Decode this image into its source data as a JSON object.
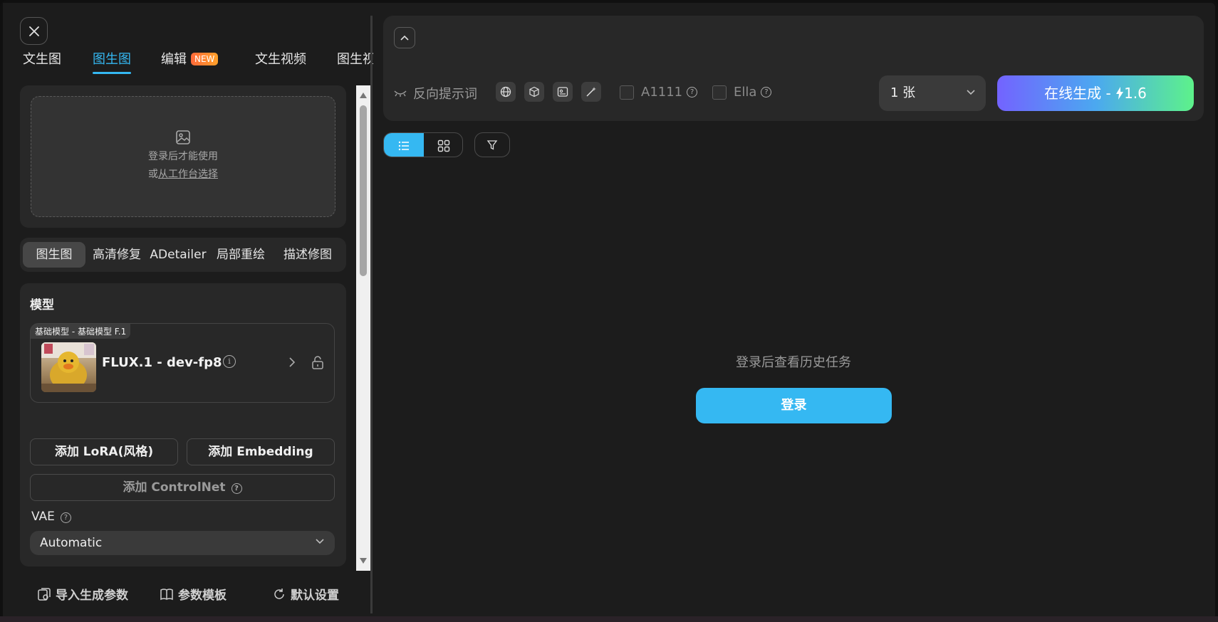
{
  "top_tabs": [
    {
      "label": "文生图",
      "active": false
    },
    {
      "label": "图生图",
      "active": true
    },
    {
      "label": "编辑",
      "badge": "NEW",
      "active": false
    },
    {
      "label": "文生视频",
      "active": false
    },
    {
      "label": "图生视",
      "active": false
    }
  ],
  "upload": {
    "line1": "登录后才能使用",
    "line2_prefix": "或",
    "line2_link": "从工作台选择"
  },
  "sub_tabs": [
    {
      "label": "图生图",
      "active": true
    },
    {
      "label": "高清修复",
      "active": false
    },
    {
      "label": "ADetailer",
      "active": false
    },
    {
      "label": "局部重绘",
      "active": false
    },
    {
      "label": "描述修图",
      "active": false
    }
  ],
  "model": {
    "section_title": "模型",
    "tag": "基础模型 - 基础模型 F.1",
    "name": "FLUX.1 - dev-fp8"
  },
  "buttons": {
    "add_lora": "添加 LoRA(风格)",
    "add_embedding": "添加 Embedding",
    "add_controlnet": "添加 ControlNet"
  },
  "vae": {
    "label": "VAE",
    "value": "Automatic"
  },
  "footer": {
    "import": "导入生成参数",
    "template": "参数模板",
    "default": "默认设置"
  },
  "prompt_bar": {
    "negative_prompt": "反向提示词",
    "checkbox_a1111": "A1111",
    "checkbox_ella": "Ella",
    "count": "1 张",
    "generate_label": "在线生成 -",
    "generate_cost": "1.6"
  },
  "history": {
    "empty_text": "登录后查看历史任务",
    "login_button": "登录"
  },
  "colors": {
    "accent": "#35b8f2",
    "badge": "#ff7a2f",
    "gen_gradient_start": "#7363ff",
    "gen_gradient_end": "#5df28a"
  }
}
